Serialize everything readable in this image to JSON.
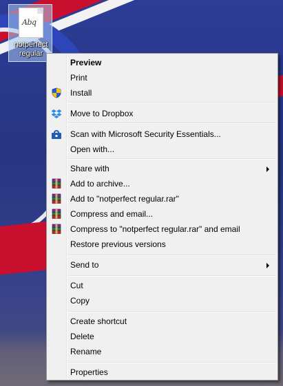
{
  "desktop": {
    "file_icon_glyph": "Abq",
    "file_label": "notperfect regular"
  },
  "context_menu": {
    "preview": "Preview",
    "print": "Print",
    "install": "Install",
    "move_to_dropbox": "Move to Dropbox",
    "scan": "Scan with Microsoft Security Essentials...",
    "open_with": "Open with...",
    "share_with": "Share with",
    "add_to_archive": "Add to archive...",
    "add_to_rar": "Add to \"notperfect regular.rar\"",
    "compress_email": "Compress and email...",
    "compress_to_rar_email": "Compress to \"notperfect regular.rar\" and email",
    "restore_previous": "Restore previous versions",
    "send_to": "Send to",
    "cut": "Cut",
    "copy": "Copy",
    "create_shortcut": "Create shortcut",
    "delete": "Delete",
    "rename": "Rename",
    "properties": "Properties"
  },
  "icons": {
    "install": "uac-shield-icon",
    "dropbox": "dropbox-icon",
    "scan": "security-essentials-icon",
    "archive": "winrar-icon",
    "submenu": "chevron-right-icon"
  },
  "colors": {
    "menu_background": "#f0f0f0",
    "menu_border": "#979797",
    "selection": "#a8c6ee"
  }
}
